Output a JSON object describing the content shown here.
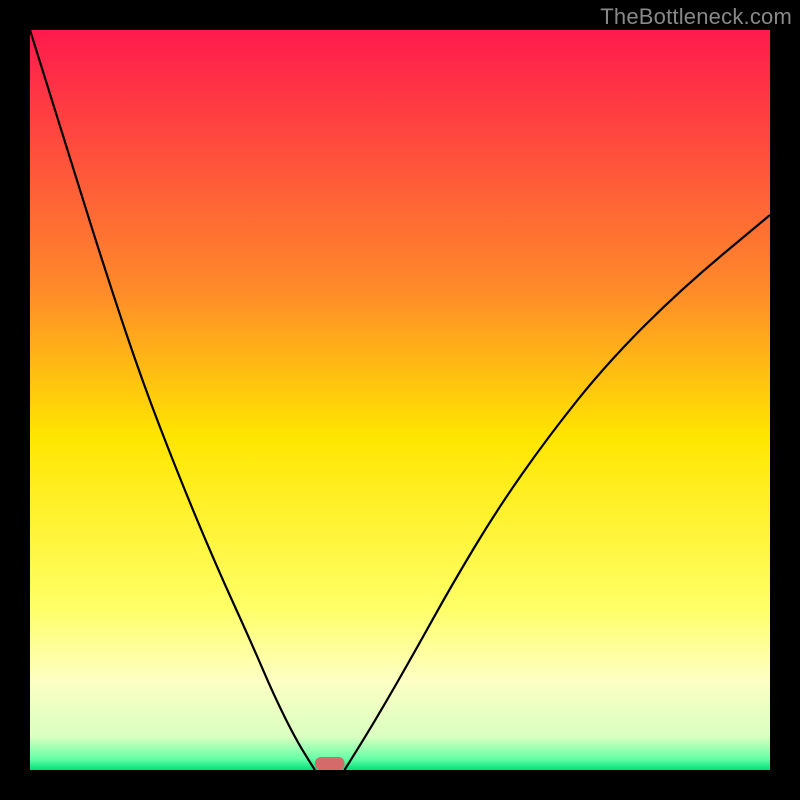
{
  "watermark": "TheBottleneck.com",
  "chart_data": {
    "type": "line",
    "title": "",
    "xlabel": "",
    "ylabel": "",
    "xlim": [
      0,
      100
    ],
    "ylim": [
      0,
      100
    ],
    "background_gradient": {
      "stops": [
        {
          "offset": 0.0,
          "color": "#ff1a4d"
        },
        {
          "offset": 0.35,
          "color": "#ff8a2a"
        },
        {
          "offset": 0.55,
          "color": "#ffe600"
        },
        {
          "offset": 0.78,
          "color": "#ffff66"
        },
        {
          "offset": 0.88,
          "color": "#fdffc4"
        },
        {
          "offset": 0.955,
          "color": "#d9ffc0"
        },
        {
          "offset": 0.985,
          "color": "#66ffa6"
        },
        {
          "offset": 1.0,
          "color": "#00e07a"
        }
      ]
    },
    "series": [
      {
        "name": "left-curve",
        "x": [
          0,
          5,
          10,
          15,
          20,
          25,
          30,
          33,
          36,
          38.5
        ],
        "y": [
          100,
          84,
          68,
          53,
          40,
          28,
          17,
          10,
          4,
          0
        ]
      },
      {
        "name": "right-curve",
        "x": [
          42.5,
          45,
          48,
          52,
          57,
          63,
          70,
          78,
          88,
          100
        ],
        "y": [
          0,
          4,
          9,
          16,
          25,
          35,
          45,
          55,
          65,
          75
        ]
      }
    ],
    "marker": {
      "name": "bottleneck-marker",
      "x_center": 40.5,
      "width": 4,
      "y": 0,
      "color": "#d46a6a"
    }
  }
}
